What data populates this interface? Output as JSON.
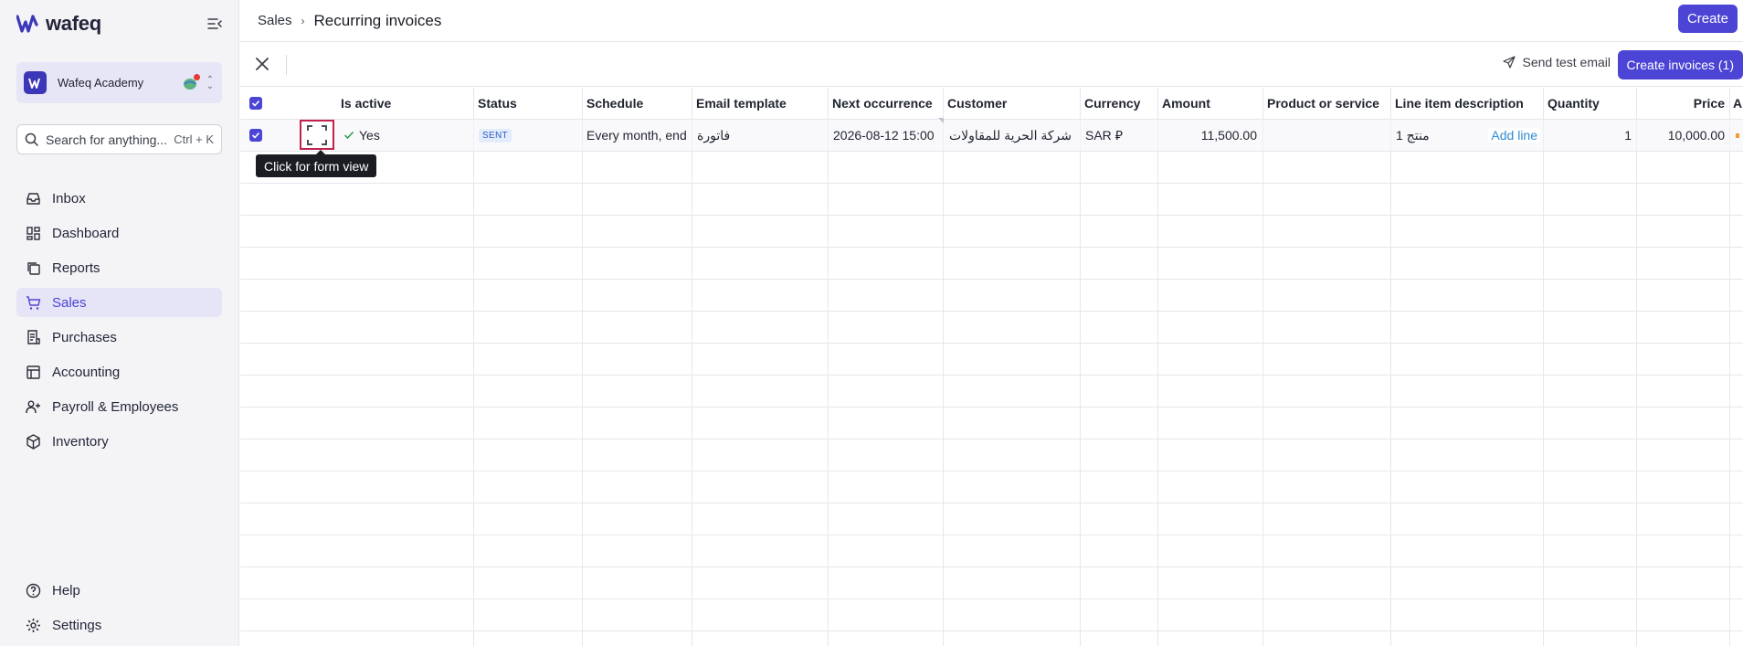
{
  "brand": {
    "name": "wafeq",
    "accent": "#4b44d4"
  },
  "organization": {
    "name": "Wafeq Academy"
  },
  "search": {
    "placeholder": "Search for anything...",
    "shortcut": "Ctrl + K"
  },
  "nav": {
    "items": [
      {
        "label": "Inbox",
        "icon": "inbox-icon"
      },
      {
        "label": "Dashboard",
        "icon": "dashboard-icon"
      },
      {
        "label": "Reports",
        "icon": "reports-icon"
      },
      {
        "label": "Sales",
        "icon": "cart-icon",
        "active": true
      },
      {
        "label": "Purchases",
        "icon": "receipt-icon"
      },
      {
        "label": "Accounting",
        "icon": "ledger-icon"
      },
      {
        "label": "Payroll & Employees",
        "icon": "people-icon"
      },
      {
        "label": "Inventory",
        "icon": "box-icon"
      }
    ],
    "bottom": [
      {
        "label": "Help",
        "icon": "help-icon"
      },
      {
        "label": "Settings",
        "icon": "gear-icon"
      }
    ]
  },
  "header": {
    "breadcrumb": "Sales",
    "title": "Recurring invoices",
    "create_label": "Create"
  },
  "toolbar": {
    "send_test_label": "Send test email",
    "create_invoices_label": "Create invoices (1)"
  },
  "table": {
    "columns": [
      "Is active",
      "Status",
      "Schedule",
      "Email template",
      "Next occurrence",
      "Customer",
      "Currency",
      "Amount",
      "Product or service",
      "Line item description",
      "Quantity",
      "Price",
      "A"
    ],
    "row": {
      "is_active": "Yes",
      "status": "SENT",
      "schedule": "Every month, end",
      "email_template": "فاتورة",
      "next_occurrence": "2026-08-12 15:00",
      "customer": "شركة الحرية للمقاولات",
      "currency": "SAR ⃁",
      "amount": "11,500.00",
      "product_or_service": "",
      "line_item_description": "منتج 1",
      "add_line_label": "Add line",
      "quantity": "1",
      "price": "10,000.00"
    },
    "tooltip": "Click for form view"
  }
}
